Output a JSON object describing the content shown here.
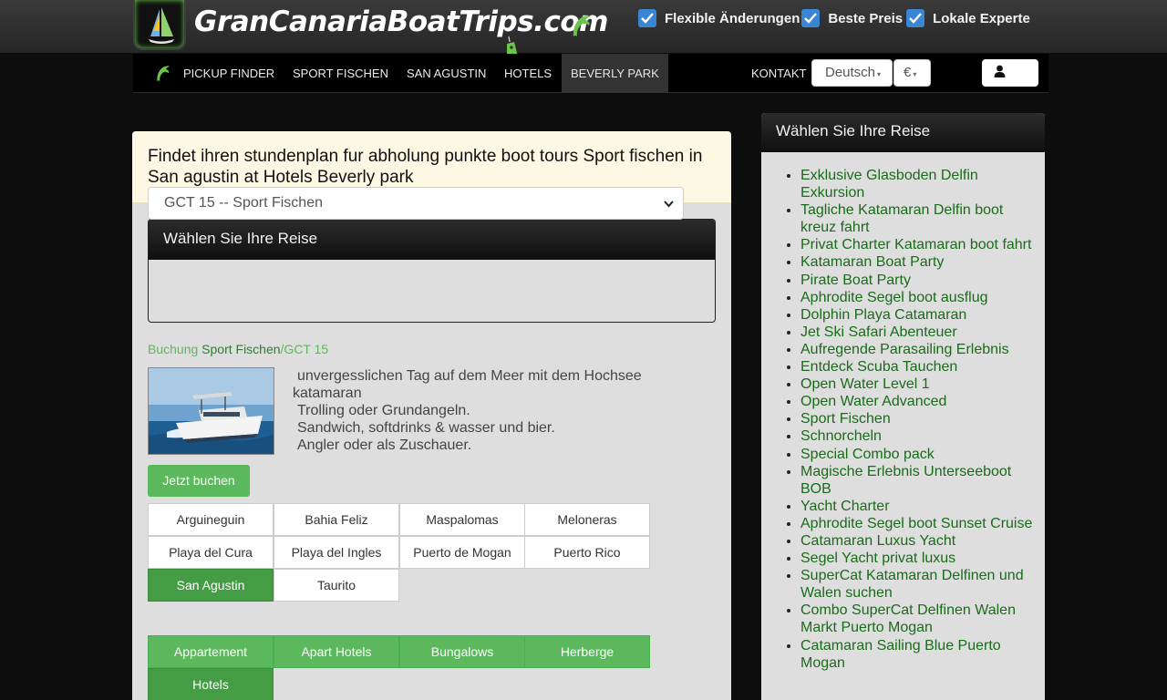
{
  "brand": {
    "name": "GranCanariaBoatTrips.com"
  },
  "features": [
    "Flexible Änderungen",
    "Beste Preis",
    "Lokale Experte"
  ],
  "nav": {
    "items": [
      "PICKUP FINDER",
      "SPORT FISCHEN",
      "SAN AGUSTIN",
      "HOTELS",
      "BEVERLY PARK"
    ],
    "active": "BEVERLY PARK",
    "contact": "KONTAKT",
    "language": "Deutsch",
    "currency": "€"
  },
  "intro": "Findet ihren stundenplan fur abholung punkte boot tours Sport fischen in San agustin at Hotels Beverly park",
  "selector": {
    "title": "Wählen Sie Ihre Reise",
    "selected": "GCT 15 -- Sport Fischen"
  },
  "breadcrumb": {
    "first": "Buchung",
    "second": "Sport Fischen",
    "third": "/GCT 15"
  },
  "description": [
    "unvergesslichen Tag auf dem Meer mit dem Hochsee",
    "katamaran",
    "Trolling oder Grundangeln.",
    "Sandwich, softdrinks & wasser und bier.",
    "Angler oder als Zuschauer."
  ],
  "book_button": "Jetzt buchen",
  "locations": [
    "Arguineguin",
    "Bahia Feliz",
    "Maspalomas",
    "Meloneras",
    "Playa del Cura",
    "Playa del Ingles",
    "Puerto de Mogan",
    "Puerto Rico",
    "San Agustin",
    "Taurito"
  ],
  "active_location": "San Agustin",
  "accommodation_types": [
    "Appartement",
    "Apart Hotels",
    "Bungalows",
    "Herberge",
    "Hotels"
  ],
  "active_type": "Hotels",
  "sidebar": {
    "title": "Wählen Sie Ihre Reise",
    "trips": [
      "Exklusive Glasboden Delfin Exkursion",
      "Tagliche Katamaran Delfin boot kreuz fahrt",
      "Privat Charter Katamaran boot fahrt",
      "Katamaran Boat Party",
      "Pirate Boat Party",
      "Aphrodite Segel boot ausflug",
      "Dolphin Playa Catamaran",
      "Jet Ski Safari Abenteuer",
      "Aufregende Parasailing Erlebnis",
      "Entdeck Scuba Tauchen",
      "Open Water Level 1",
      "Open Water Advanced",
      "Sport Fischen",
      "Schnorcheln",
      "Special Combo pack",
      "Magische Erlebnis Unterseeboot BOB",
      "Yacht Charter",
      "Aphrodite Segel boot Sunset Cruise",
      "Catamaran Luxus Yacht",
      "Segel Yacht privat luxus",
      "SuperCat Katamaran Delfinen und Walen suchen",
      "Combo SuperCat Delfinen Walen Markt Puerto Mogan",
      "Catamaran Sailing Blue Puerto Mogan"
    ]
  },
  "colors": {
    "accent": "#5cb85c",
    "active": "#449d44",
    "link": "#1a6b1a",
    "checkbox": "#3a86d4",
    "notice": "#fcf8e3"
  }
}
